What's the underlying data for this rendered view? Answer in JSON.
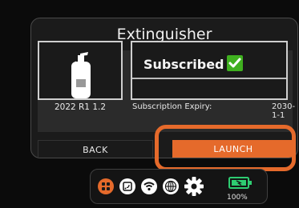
{
  "app": {
    "title": "Extinguisher",
    "version": "2022 R1 1.2",
    "status": "Subscribed",
    "expiry_label": "Subscription Expiry:",
    "expiry_value": "2030-1-1"
  },
  "buttons": {
    "back_label": "BACK",
    "launch_label": "LAUNCH"
  },
  "taskbar": {
    "battery_text": "100%",
    "battery_level_percent": 100,
    "icons": [
      "apps-icon",
      "tablet-icon",
      "wifi-icon",
      "globe-icon",
      "gear-icon",
      "battery-icon"
    ]
  },
  "colors": {
    "accent": "#e56a2b",
    "check": "#3fb01f",
    "battery": "#2ecc71"
  }
}
